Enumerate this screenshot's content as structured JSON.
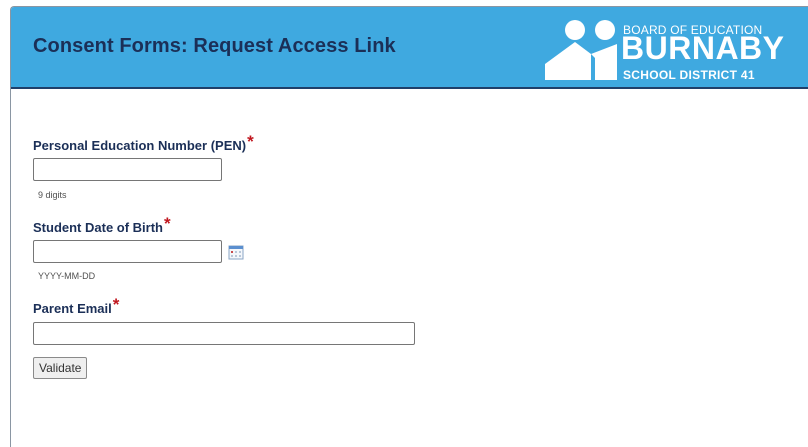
{
  "header": {
    "title": "Consent Forms: Request Access Link",
    "logo": {
      "line1": "BOARD OF EDUCATION",
      "line2": "BURNABY",
      "line3": "SCHOOL DISTRICT 41"
    }
  },
  "form": {
    "required_marker": "*",
    "pen": {
      "label": "Personal Education Number (PEN)",
      "value": "",
      "hint": "9 digits"
    },
    "dob": {
      "label": "Student Date of Birth",
      "value": "",
      "hint": "YYYY-MM-DD"
    },
    "email": {
      "label": "Parent Email",
      "value": ""
    },
    "validate_label": "Validate"
  },
  "colors": {
    "header_bg": "#3fa9e0",
    "title": "#1b2f57",
    "required": "#c0161e"
  },
  "icons": {
    "calendar": "calendar-icon",
    "logo": "burnaby-logo"
  }
}
